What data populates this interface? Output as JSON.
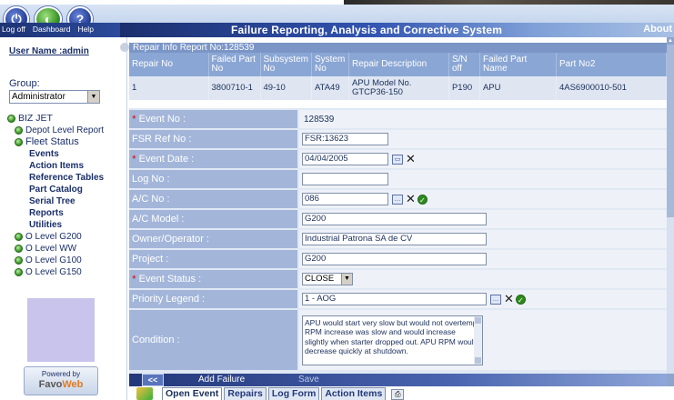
{
  "topbar": {
    "icons": [
      {
        "name": "log-off-icon",
        "label": "Log off"
      },
      {
        "name": "dashboard-icon",
        "label": "Dashboard"
      },
      {
        "name": "help-icon",
        "label": "Help"
      }
    ],
    "app_title": "Failure Reporting, Analysis and Corrective System",
    "about_label": "About"
  },
  "sidebar": {
    "user_name": "User Name :admin",
    "group_label": "Group:",
    "group_value": "Administrator",
    "tree": [
      {
        "label": "BIZ JET",
        "level": 1,
        "bullet": true
      },
      {
        "label": "Depot Level Report",
        "level": 2,
        "bullet": true
      },
      {
        "label": "Fleet Status",
        "level": 2,
        "bullet": true
      },
      {
        "label": "Events",
        "level": 3
      },
      {
        "label": "Action Items",
        "level": 3
      },
      {
        "label": "Reference Tables",
        "level": 3
      },
      {
        "label": "Part Catalog",
        "level": 3
      },
      {
        "label": "Serial Tree",
        "level": 3
      },
      {
        "label": "Reports",
        "level": 3
      },
      {
        "label": "Utilities",
        "level": 3
      },
      {
        "label": "O Level G200",
        "level": 2,
        "bullet": true
      },
      {
        "label": "O Level WW",
        "level": 2,
        "bullet": true
      },
      {
        "label": "O Level G100",
        "level": 2,
        "bullet": true
      },
      {
        "label": "O Level G150",
        "level": 2,
        "bullet": true
      }
    ],
    "powered_by": "Powered by",
    "brand_a": "Favo",
    "brand_b": "Web"
  },
  "repair_info": {
    "header": "Repair Info  Report No:128539",
    "columns": [
      "Repair No",
      "Failed Part No",
      "Subsystem No",
      "System No",
      "Repair Description",
      "S/N off",
      "Failed Part Name",
      "Part No2"
    ],
    "rows": [
      [
        "1",
        "3800710-1",
        "49-10",
        "ATA49",
        "APU Model No. GTCP36-150",
        "P190",
        "APU",
        "4AS6900010-501"
      ]
    ]
  },
  "form": {
    "event_no_label": "Event No :",
    "event_no_value": "128539",
    "fsr_label": "FSR Ref No :",
    "fsr_value": "FSR:13623",
    "event_date_label": "Event Date :",
    "event_date_value": "04/04/2005",
    "log_no_label": "Log No :",
    "log_no_value": "",
    "ac_no_label": "A/C No :",
    "ac_no_value": "086",
    "ac_model_label": "A/C Model :",
    "ac_model_value": "G200",
    "owner_label": "Owner/Operator :",
    "owner_value": "Industrial Patrona SA de CV",
    "project_label": "Project :",
    "project_value": "G200",
    "event_status_label": "Event Status :",
    "event_status_value": "CLOSE",
    "priority_label": "Priority Legend :",
    "priority_value": "1 - AOG",
    "condition_label": "Condition :",
    "condition_value": "APU would start very slow but would not overtemp. RPM increase was slow and would increase slightly when starter dropped out. APU RPM would decrease quickly at shutdown."
  },
  "actions": {
    "back_label": "<<",
    "add_failure_label": "Add Failure",
    "save_label": "Save"
  },
  "tabs": [
    "Open Event",
    "Repairs",
    "Log Form",
    "Action Items"
  ]
}
